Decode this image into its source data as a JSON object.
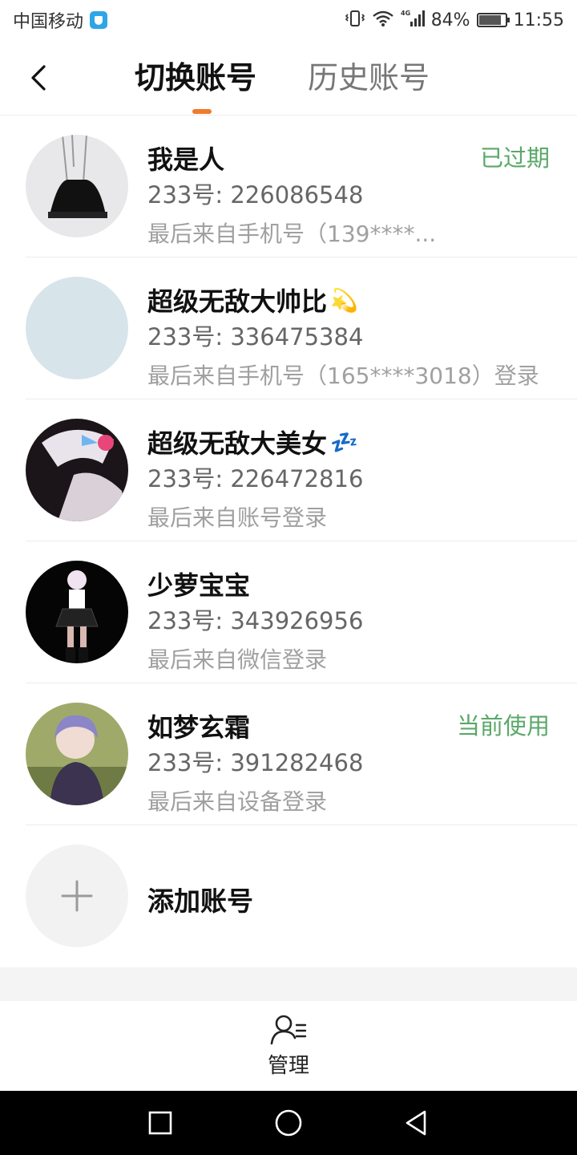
{
  "status_bar": {
    "carrier": "中国移动",
    "signal_label": "4G",
    "battery": "84%",
    "battery_level": 0.84,
    "time": "11:55"
  },
  "header": {
    "tab_active": "切换账号",
    "tab_inactive": "历史账号"
  },
  "accounts": [
    {
      "name": "我是人",
      "name_emoji": "",
      "id_text": "233号: 226086548",
      "last_login": "最后来自手机号（139****...",
      "status": "已过期",
      "status_color": "#5aa869"
    },
    {
      "name": "超级无敌大帅比",
      "name_emoji": "💫",
      "id_text": "233号: 336475384",
      "last_login": "最后来自手机号（165****3018）登录",
      "status": "",
      "status_color": "#5aa869"
    },
    {
      "name": "超级无敌大美女",
      "name_emoji": "💤",
      "id_text": "233号: 226472816",
      "last_login": "最后来自账号登录",
      "status": "",
      "status_color": "#5aa869"
    },
    {
      "name": "少萝宝宝",
      "name_emoji": "",
      "id_text": "233号: 343926956",
      "last_login": "最后来自微信登录",
      "status": "",
      "status_color": "#5aa869"
    },
    {
      "name": "如梦玄霜",
      "name_emoji": "",
      "id_text": "233号: 391282468",
      "last_login": "最后来自设备登录",
      "status": "当前使用",
      "status_color": "#5aa869"
    }
  ],
  "add_account": {
    "label": "添加账号"
  },
  "bottom": {
    "manage_label": "管理"
  },
  "colors": {
    "accent": "#f07a2b",
    "status_green": "#5aa869"
  }
}
